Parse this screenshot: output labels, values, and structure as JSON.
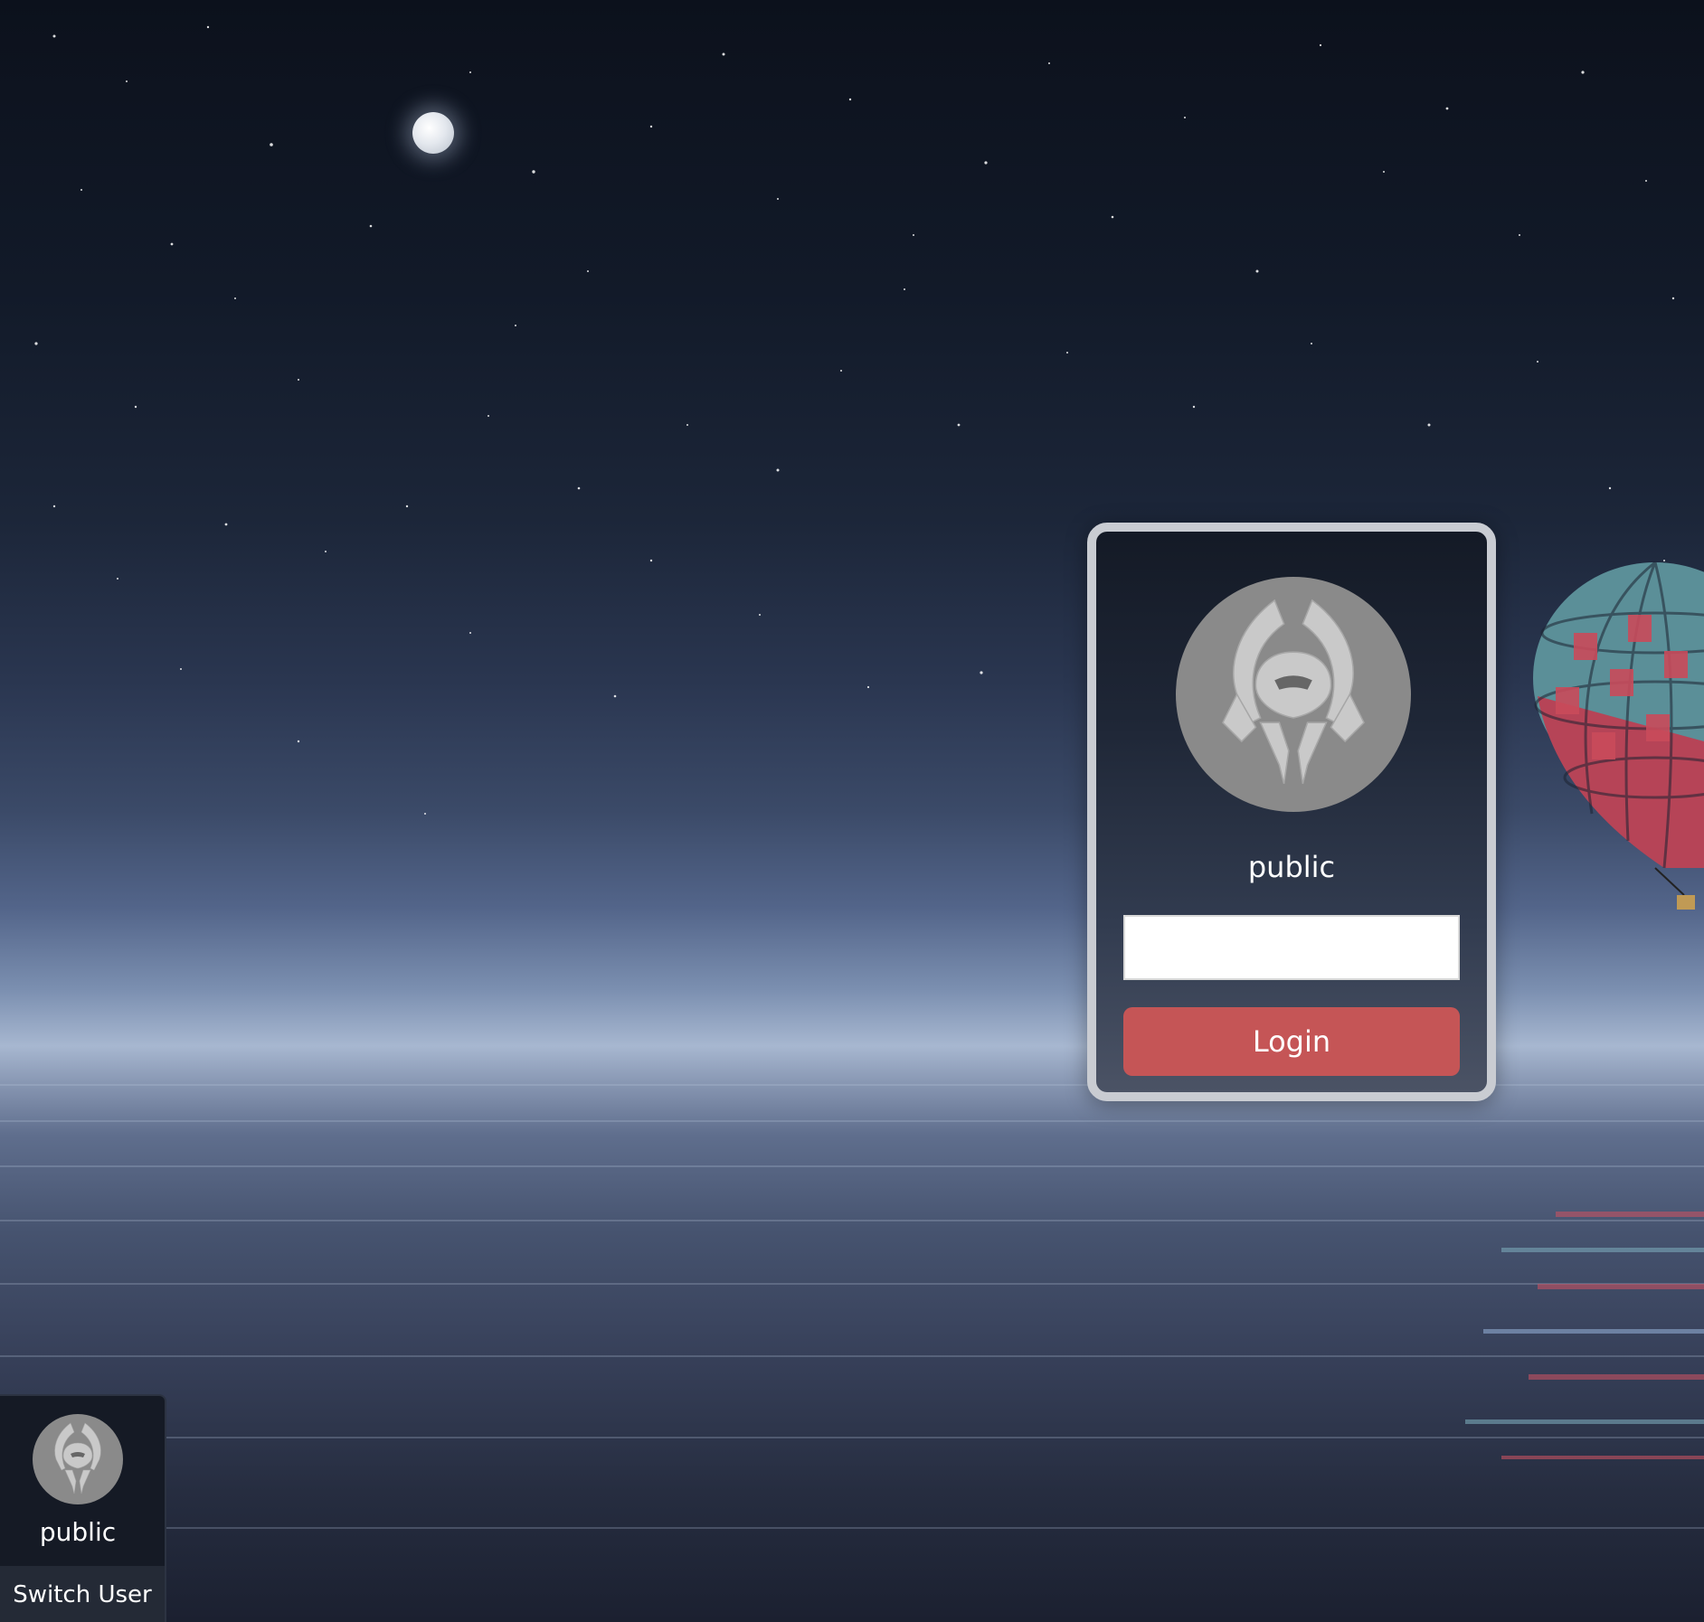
{
  "login": {
    "username": "public",
    "password_value": "",
    "login_label": "Login"
  },
  "user_panel": {
    "username": "public",
    "switch_user_label": "Switch User"
  },
  "icons": {
    "avatar": "winged-helmet-emblem-icon"
  },
  "colors": {
    "login_button": "#c55556",
    "card_border": "#c9ccd2",
    "avatar_bg": "#8a8a8a"
  }
}
